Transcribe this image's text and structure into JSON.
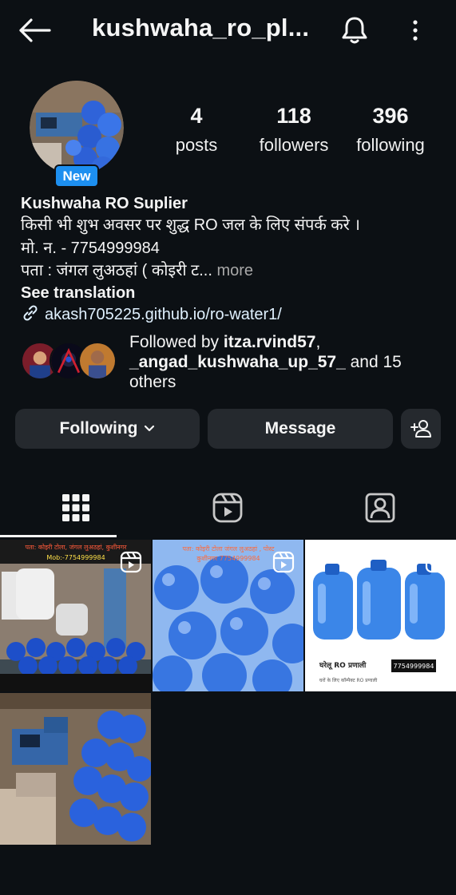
{
  "header": {
    "username": "kushwaha_ro_pl..."
  },
  "profile": {
    "new_badge": "New",
    "stats": [
      {
        "value": "4",
        "label": "posts"
      },
      {
        "value": "118",
        "label": "followers"
      },
      {
        "value": "396",
        "label": "following"
      }
    ],
    "name": "Kushwaha RO Suplier",
    "bio_line1": "किसी भी शुभ अवसर पर शुद्ध RO जल के लिए संपर्क करे ।",
    "bio_line2": "मो. न. - 7754999984",
    "bio_line3": "पता :  जंगल लुअठहां ( कोइरी ट...",
    "bio_more": "more",
    "see_translation": "See translation",
    "link": "akash705225.github.io/ro-water1/",
    "followed_by_prefix": "Followed by ",
    "followed_by_user1": "itza.rvind57",
    "followed_by_sep": ", ",
    "followed_by_user2": "_angad_kushwaha_up_57_",
    "followed_by_suffix": " and 15 others"
  },
  "actions": {
    "following": "Following",
    "message": "Message"
  },
  "posts": [
    {
      "overlay_line1": "पता: कोइरी टोला, जंगल लुअठहां, कुशीनगर",
      "overlay_line2": "Mob:-7754999984"
    },
    {
      "overlay_line1": "पता: कोइरी टोला जंगल लुअठहां , पोस्ट",
      "overlay_line2": "कुशीनगर 7754999984"
    },
    {
      "overlay_title": "घरेलू RO प्रणाली",
      "overlay_phone": "7754999984",
      "overlay_sub": "घरों के लिए कॉम्पैक्ट RO प्रणाली"
    },
    {}
  ],
  "colors": {
    "background": "#0c1014",
    "button": "#25292e",
    "badge": "#1d8ff0",
    "link": "#e0f1ff",
    "muted": "#a8a8a8"
  }
}
